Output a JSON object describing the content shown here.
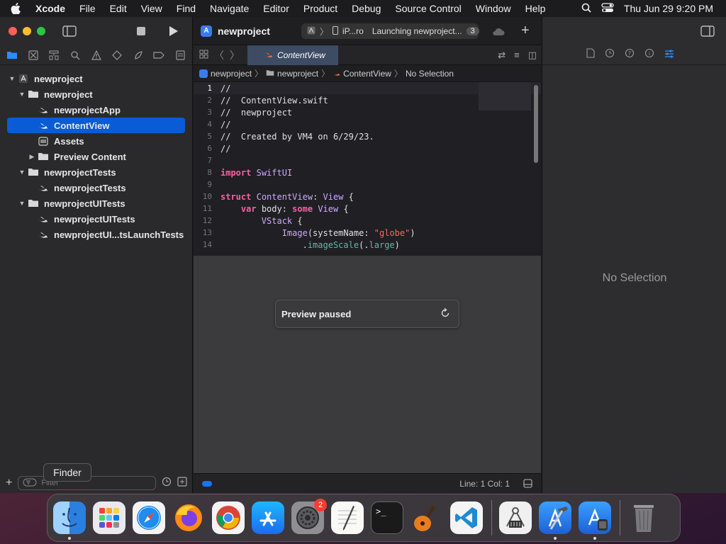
{
  "menubar": {
    "app_name": "Xcode",
    "items": [
      "File",
      "Edit",
      "View",
      "Find",
      "Navigate",
      "Editor",
      "Product",
      "Debug",
      "Source Control",
      "Window",
      "Help"
    ],
    "datetime": "Thu Jun 29  9:20 PM"
  },
  "toolbar": {
    "project_title": "newproject",
    "scheme_device": "iP...ro",
    "activity_status": "Launching newproject...",
    "activity_count": "3"
  },
  "navigator": {
    "items": [
      {
        "label": "newproject"
      },
      {
        "label": "newproject"
      },
      {
        "label": "newprojectApp"
      },
      {
        "label": "ContentView"
      },
      {
        "label": "Assets"
      },
      {
        "label": "Preview Content"
      },
      {
        "label": "newprojectTests"
      },
      {
        "label": "newprojectTests"
      },
      {
        "label": "newprojectUITests"
      },
      {
        "label": "newprojectUITests"
      },
      {
        "label": "newprojectUI...tsLaunchTests"
      }
    ],
    "filter_placeholder": "Filter"
  },
  "tooltip": "Finder",
  "editor": {
    "tab_title": "ContentView",
    "breadcrumb": [
      "newproject",
      "newproject",
      "ContentView",
      "No Selection"
    ],
    "code_lines": [
      "//",
      "//  ContentView.swift",
      "//  newproject",
      "//",
      "//  Created by VM4 on 6/29/23.",
      "//",
      "",
      "import SwiftUI",
      "",
      "struct ContentView: View {",
      "    var body: some View {",
      "        VStack {",
      "            Image(systemName: \"globe\")",
      "                .imageScale(.large)"
    ],
    "line_numbers": [
      "1",
      "2",
      "3",
      "4",
      "5",
      "6",
      "7",
      "8",
      "9",
      "10",
      "11",
      "12",
      "13",
      "14"
    ],
    "preview_status": "Preview paused",
    "cursor_position": "Line: 1  Col: 1"
  },
  "inspector": {
    "empty_text": "No Selection"
  },
  "dock": {
    "apps": [
      "Finder",
      "Launchpad",
      "Safari",
      "Firefox",
      "Google Chrome",
      "App Store",
      "System Settings",
      "TextEdit",
      "Terminal",
      "GarageBand",
      "Visual Studio Code",
      "Instruments",
      "Xcode",
      "Simulator",
      "Trash"
    ],
    "settings_badge": "2"
  }
}
